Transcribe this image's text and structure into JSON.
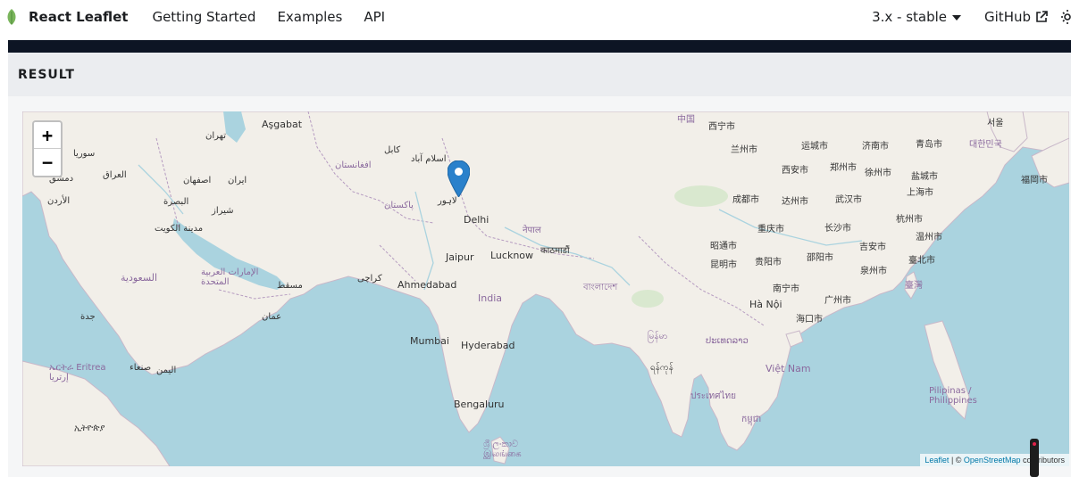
{
  "nav": {
    "brand": "React Leaflet",
    "links": [
      "Getting Started",
      "Examples",
      "API"
    ],
    "version": "3.x - stable",
    "github": "GitHub"
  },
  "result": {
    "label": "RESULT"
  },
  "map": {
    "zoom_in": "+",
    "zoom_out": "−",
    "attribution": {
      "leaflet": "Leaflet",
      "sep": " | © ",
      "osm": "OpenStreetMap",
      "suffix": " contributors"
    },
    "labels": {
      "ashgabat": "Aşgabat",
      "tehran": "تهران",
      "syria": "سوريا",
      "iraq": "العراق",
      "damascus": "دمشق",
      "jordan": "الأردن",
      "esfahan": "اصفهان",
      "iran": "ایران",
      "basra": "البصرة",
      "shiraz": "شیراز",
      "kuwait": "مدينة الكويت",
      "saudi": "السعودية",
      "uae": "الإمارات العربية المتحدة",
      "muscat": "مسقط",
      "oman": "عمان",
      "jeddah": "جدة",
      "yemen": "اليمن",
      "sanaa": "صنعاء",
      "eritrea": "ኤርትራ Eritrea إرتريا",
      "ethiopia": "ኢትዮጵያ",
      "afghanistan": "افغانستان",
      "kabul": "کابل",
      "islamabad": "اسلام آباد",
      "pakistan": "پاکستان",
      "lahore": "لاہور",
      "karachi": "کراچی",
      "delhi": "Delhi",
      "nepal": "नेपाल",
      "kathmandu": "काठमाडौं",
      "jaipur": "Jaipur",
      "lucknow": "Lucknow",
      "ahmedabad": "Ahmedabad",
      "india": "India",
      "bangladesh": "বাংলাদেশ",
      "mumbai": "Mumbai",
      "hyderabad": "Hyderabad",
      "bengaluru": "Bengaluru",
      "srilanka": "ශ්‍රී ලංකාව இலங்கை",
      "myanmar": "မြန်မာ",
      "yangon": "ရန်ကုန်",
      "china": "中国",
      "xining": "西宁市",
      "lanzhou": "兰州市",
      "xian": "西安市",
      "chengdu": "成都市",
      "chongqing": "重庆市",
      "dazhou": "达州市",
      "wuhan": "武汉市",
      "changsha": "长沙市",
      "guiyang": "贵阳市",
      "kunming": "昆明市",
      "zhaotong": "昭通市",
      "shaoyang": "邵阳市",
      "nanning": "南宁市",
      "guangzhou": "广州市",
      "haikou": "海口市",
      "hanoi": "Hà Nội",
      "laos": "ປະເທດລາວ",
      "vietnam": "Việt Nam",
      "thailand": "ประเทศไทย",
      "cambodia": "កម្ពុជា",
      "yuncheng": "运城市",
      "zhengzhou": "郑州市",
      "jinan": "济南市",
      "qingdao": "青岛市",
      "xuzhou": "徐州市",
      "yancheng": "盐城市",
      "shanghai": "上海市",
      "hangzhou": "杭州市",
      "wenzhou": "温州市",
      "taipei": "臺北市",
      "taiwan": "臺灣",
      "quanzhou": "泉州市",
      "jian": "吉安市",
      "korea": "대한민국",
      "seoul": "서울",
      "fukuoka": "福岡市",
      "philippines": "Pilipinas / Philippines"
    }
  }
}
